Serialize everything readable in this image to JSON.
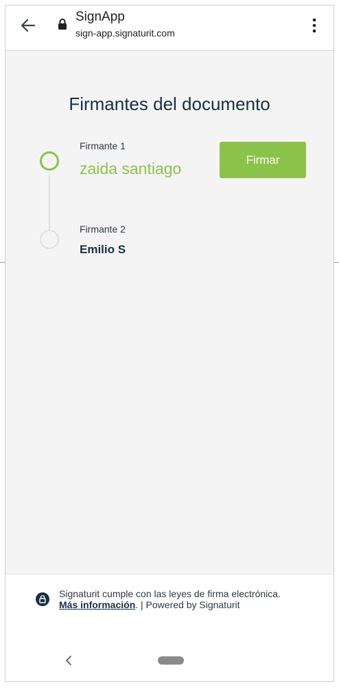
{
  "browser": {
    "title": "SignApp",
    "url": "sign-app.signaturit.com"
  },
  "page": {
    "title": "Firmantes del documento"
  },
  "signers": [
    {
      "caption": "Firmante 1",
      "name": "zaida santiago",
      "status": "active"
    },
    {
      "caption": "Firmante 2",
      "name": "Emilio S",
      "status": "pending"
    }
  ],
  "actions": {
    "sign_label": "Firmar"
  },
  "footer": {
    "text_before": "Signaturit cumple con las leyes de firma electrónica. ",
    "link_text": "Más información",
    "text_after": ". | Powered by Signaturit"
  },
  "colors": {
    "accent": "#8bc34a",
    "dark": "#17323f",
    "background": "#f4f4f4"
  },
  "icons": {
    "back": "arrow-left-icon",
    "lock": "lock-icon",
    "menu": "more-vert-icon",
    "nav_back": "chevron-left-icon",
    "nav_home": "home-pill-icon"
  }
}
